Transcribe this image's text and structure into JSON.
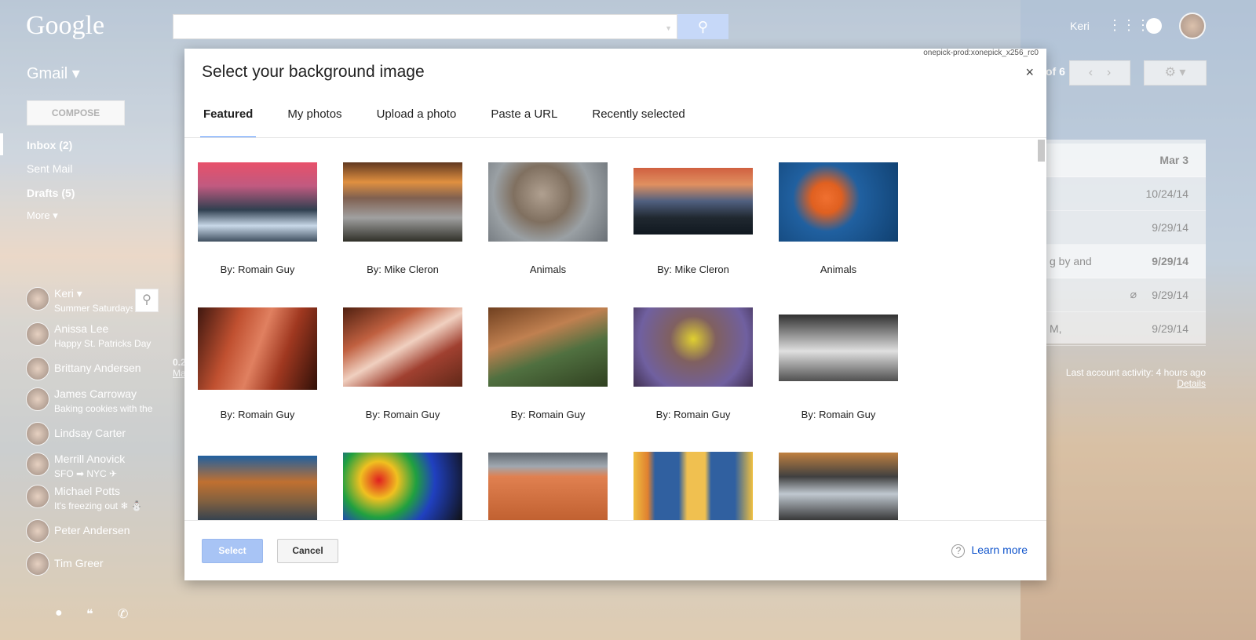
{
  "header": {
    "logo": "Google",
    "user": "Keri",
    "search_icon": "search-icon",
    "apps_icon": "apps-grid-icon"
  },
  "gmail": {
    "label": "Gmail ▾",
    "compose": "COMPOSE",
    "nav": [
      "Inbox (2)",
      "Sent Mail",
      "Drafts (5)",
      "More ▾"
    ],
    "pagination": "of 6"
  },
  "chat": {
    "me": {
      "name": "Keri ▾",
      "status": "Summer Saturdays"
    },
    "contacts": [
      {
        "name": "Anissa Lee",
        "status": "Happy St. Patricks Day"
      },
      {
        "name": "Brittany Andersen",
        "status": ""
      },
      {
        "name": "James Carroway",
        "status": "Baking cookies with the"
      },
      {
        "name": "Lindsay Carter",
        "status": ""
      },
      {
        "name": "Merrill Anovick",
        "status": "SFO ➡ NYC ✈"
      },
      {
        "name": "Michael Potts",
        "status": "It's freezing out ❄ ⛄"
      },
      {
        "name": "Peter Andersen",
        "status": ""
      },
      {
        "name": "Tim Greer",
        "status": ""
      }
    ]
  },
  "mail_rows": [
    {
      "snippet": "",
      "date": "Mar 3"
    },
    {
      "snippet": "",
      "date": "10/24/14"
    },
    {
      "snippet": "",
      "date": "9/29/14"
    },
    {
      "snippet": "g by and",
      "date": "9/29/14"
    },
    {
      "snippet": "",
      "date": "9/29/14"
    },
    {
      "snippet": "M,",
      "date": "9/29/14"
    }
  ],
  "left_partial": {
    "size": "0.2",
    "link": "Ma"
  },
  "activity": {
    "text": "Last account activity: 4 hours ago",
    "details": "Details"
  },
  "dialog": {
    "version": "onepick-prod:xonepick_x256_rc0",
    "title": "Select your background image",
    "close": "×",
    "tabs": [
      "Featured",
      "My photos",
      "Upload a photo",
      "Paste a URL",
      "Recently selected"
    ],
    "images": [
      {
        "caption": "By: Romain Guy"
      },
      {
        "caption": "By: Mike Cleron"
      },
      {
        "caption": "Animals"
      },
      {
        "caption": "By: Mike Cleron"
      },
      {
        "caption": "Animals"
      },
      {
        "caption": "By: Romain Guy"
      },
      {
        "caption": "By: Romain Guy"
      },
      {
        "caption": "By: Romain Guy"
      },
      {
        "caption": "By: Romain Guy"
      },
      {
        "caption": "By: Romain Guy"
      },
      {
        "caption": ""
      },
      {
        "caption": ""
      },
      {
        "caption": ""
      },
      {
        "caption": ""
      },
      {
        "caption": ""
      }
    ],
    "select": "Select",
    "cancel": "Cancel",
    "learn_more": "Learn more",
    "help": "?"
  }
}
